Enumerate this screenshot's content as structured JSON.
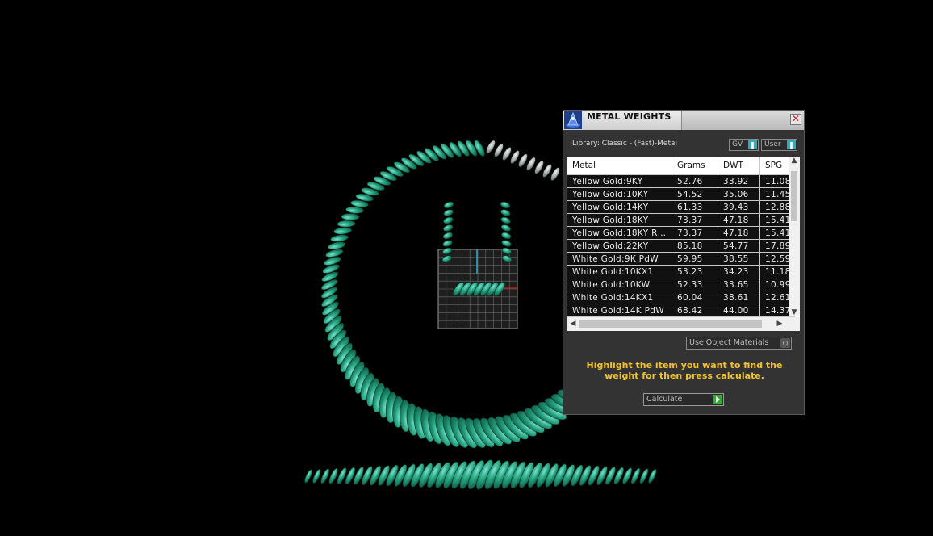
{
  "panel": {
    "title": "METAL WEIGHTS",
    "close_glyph": "✕",
    "library_label": "Library: Classic - (Fast)-Metal",
    "gv_label": "GV",
    "user_label": "User",
    "columns": [
      "Metal",
      "Grams",
      "DWT",
      "SPG"
    ],
    "rows": [
      [
        "Yellow Gold:9KY",
        "52.76",
        "33.92",
        "11.08"
      ],
      [
        "Yellow Gold:10KY",
        "54.52",
        "35.06",
        "11.45"
      ],
      [
        "Yellow Gold:14KY",
        "61.33",
        "39.43",
        "12.88"
      ],
      [
        "Yellow Gold:18KY",
        "73.37",
        "47.18",
        "15.41"
      ],
      [
        "Yellow Gold:18KY R…",
        "73.37",
        "47.18",
        "15.41"
      ],
      [
        "Yellow Gold:22KY",
        "85.18",
        "54.77",
        "17.89"
      ],
      [
        "White Gold:9K PdW",
        "59.95",
        "38.55",
        "12.59"
      ],
      [
        "White Gold:10KX1",
        "53.23",
        "34.23",
        "11.18"
      ],
      [
        "White Gold:10KW",
        "52.33",
        "33.65",
        "10.99"
      ],
      [
        "White Gold:14KX1",
        "60.04",
        "38.61",
        "12.61"
      ],
      [
        "White Gold:14K PdW",
        "68.42",
        "44.00",
        "14.37"
      ]
    ],
    "use_object_materials_label": "Use Object Materials",
    "hint": "Highlight the item you want to find the weight for then press calculate.",
    "calculate_label": "Calculate"
  },
  "colors": {
    "chain": "#1f8f6a",
    "chain_silver": "#b8b8b8",
    "hint": "#f2c12e",
    "accent": "#38a7b8"
  },
  "icons": [
    "app-logo-icon",
    "close-icon",
    "scroll-up-icon",
    "scroll-down-icon",
    "scroll-left-icon",
    "scroll-right-icon",
    "play-icon"
  ]
}
